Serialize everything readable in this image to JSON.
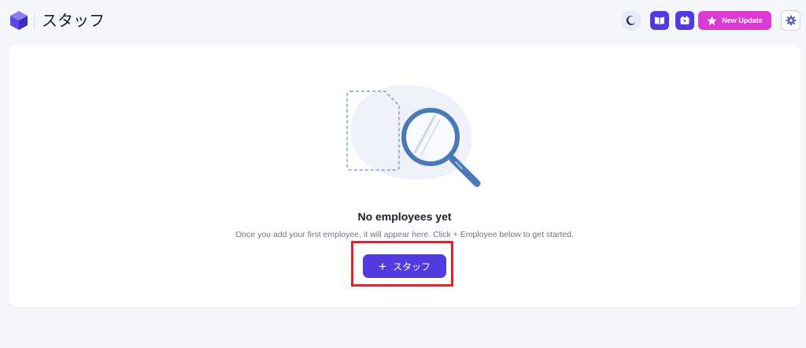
{
  "header": {
    "title": "スタッフ",
    "update_label": "New Update"
  },
  "empty_state": {
    "title": "No employees yet",
    "description": "Once you add your first employee, it will appear here. Click + Employee below to get started.",
    "button_plus": "+",
    "button_label": "スタッフ"
  },
  "icons": {
    "logo": "cube-logo",
    "theme": "moon-icon",
    "guide": "book-icon",
    "video": "video-icon",
    "update": "star-icon",
    "settings": "gear-icon",
    "illustration": "magnifier-illustration"
  },
  "colors": {
    "accent": "#4f3be0",
    "update": "#dc3bd3",
    "highlight": "#e5202b",
    "illustration": "#4a7ab5"
  }
}
